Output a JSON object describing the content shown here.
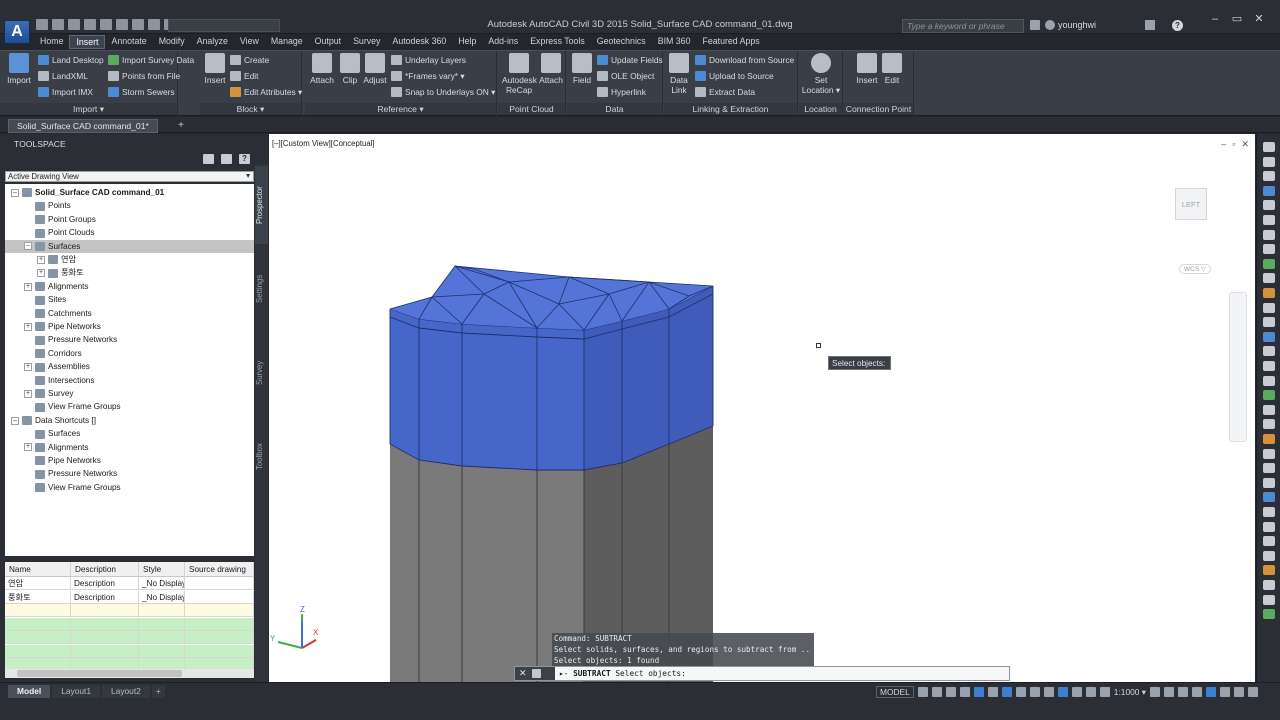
{
  "app": {
    "logo_letter": "A",
    "window_title": "Autodesk AutoCAD Civil 3D 2015    Solid_Surface CAD command_01.dwg",
    "search_placeholder": "Type a keyword or phrase",
    "user_name": "younghwi",
    "window_controls": [
      "–",
      "▭",
      "✕"
    ]
  },
  "menu_tabs": [
    "Home",
    "Insert",
    "Annotate",
    "Modify",
    "Analyze",
    "View",
    "Manage",
    "Output",
    "Survey",
    "Autodesk 360",
    "Help",
    "Add-ins",
    "Express Tools",
    "Geotechnics",
    "BIM 360",
    "Featured Apps"
  ],
  "active_menu_tab": "Insert",
  "ribbon": {
    "import_panel": {
      "title": "Import ▾",
      "big_button": "Import",
      "items": [
        "Land Desktop",
        "LandXML",
        "Import IMX",
        "Import Survey Data",
        "Points from File",
        "Storm Sewers"
      ]
    },
    "block_panel": {
      "title": "Block ▾",
      "big_button": "Insert",
      "items": [
        "Create",
        "Edit",
        "Edit Attributes ▾"
      ]
    },
    "reference_panel": {
      "title": "Reference ▾",
      "buttons": [
        "Attach",
        "Clip",
        "Adjust"
      ],
      "items": [
        "Underlay Layers",
        "*Frames vary* ▾",
        "Snap to Underlays ON ▾"
      ]
    },
    "pointcloud_panel": {
      "title": "Point Cloud",
      "buttons": [
        "Autodesk\nReCap",
        "Attach"
      ]
    },
    "data_panel": {
      "title": "Data",
      "big_button": "Field",
      "items": [
        "Update Fields",
        "OLE Object",
        "Hyperlink"
      ]
    },
    "linking_panel": {
      "title": "Linking & Extraction",
      "big_button": "Data\nLink",
      "items": [
        "Download from Source",
        "Upload to Source",
        "Extract  Data"
      ]
    },
    "location_panel": {
      "title": "Location",
      "big_button": "Set\nLocation ▾"
    },
    "connection_panel": {
      "title": "Connection Point",
      "buttons": [
        "Insert",
        "Edit"
      ]
    }
  },
  "file_tab": "Solid_Surface CAD command_01*",
  "toolspace": {
    "title": "TOOLSPACE",
    "view_select": "Active Drawing View",
    "side_tabs": [
      "Prospector",
      "Settings",
      "Survey",
      "Toolbox"
    ],
    "tree": [
      {
        "label": "Solid_Surface CAD command_01",
        "level": 0,
        "toggle": "–",
        "bold": true
      },
      {
        "label": "Points",
        "level": 1
      },
      {
        "label": "Point Groups",
        "level": 1
      },
      {
        "label": "Point Clouds",
        "level": 1
      },
      {
        "label": "Surfaces",
        "level": 1,
        "toggle": "–",
        "selected": true
      },
      {
        "label": "연암",
        "level": 2,
        "toggle": "+"
      },
      {
        "label": "풍화토",
        "level": 2,
        "toggle": "+"
      },
      {
        "label": "Alignments",
        "level": 1,
        "toggle": "+"
      },
      {
        "label": "Sites",
        "level": 1
      },
      {
        "label": "Catchments",
        "level": 1
      },
      {
        "label": "Pipe Networks",
        "level": 1,
        "toggle": "+"
      },
      {
        "label": "Pressure Networks",
        "level": 1
      },
      {
        "label": "Corridors",
        "level": 1
      },
      {
        "label": "Assemblies",
        "level": 1,
        "toggle": "+"
      },
      {
        "label": "Intersections",
        "level": 1
      },
      {
        "label": "Survey",
        "level": 1,
        "toggle": "+"
      },
      {
        "label": "View Frame Groups",
        "level": 1
      },
      {
        "label": "Data Shortcuts []",
        "level": 0,
        "toggle": "–"
      },
      {
        "label": "Surfaces",
        "level": 1
      },
      {
        "label": "Alignments",
        "level": 1,
        "toggle": "+"
      },
      {
        "label": "Pipe Networks",
        "level": 1
      },
      {
        "label": "Pressure Networks",
        "level": 1
      },
      {
        "label": "View Frame Groups",
        "level": 1
      }
    ],
    "item_list": {
      "columns": [
        "Name",
        "Description",
        "Style",
        "Source drawing"
      ],
      "rows": [
        [
          "연암",
          "Description",
          "_No Display",
          ""
        ],
        [
          "풍화토",
          "Description",
          "_No Display",
          ""
        ]
      ]
    }
  },
  "viewport": {
    "label": "[–][Custom View][Conceptual]",
    "controls": [
      "–",
      "▫",
      "✕"
    ],
    "viewcube_face": "LEFT",
    "wcs_badge": "WCS ▽",
    "tooltip": "Select objects:",
    "ucs_labels": [
      "Z",
      "Y",
      "X"
    ],
    "solid_top_color": "#4a6ad0",
    "solid_side_color": "#7a7a7a"
  },
  "command": {
    "history": [
      "Command: SUBTRACT",
      "Select solids, surfaces, and regions to subtract from ..",
      "Select objects: 1 found"
    ],
    "current_cmd": "SUBTRACT",
    "current_prompt": "Select objects:",
    "buttons": [
      "✕",
      "🔧"
    ]
  },
  "status": {
    "layout_tabs": [
      "Model",
      "Layout1",
      "Layout2",
      "+"
    ],
    "model_label": "MODEL",
    "scale": "1:1000 ▾"
  }
}
